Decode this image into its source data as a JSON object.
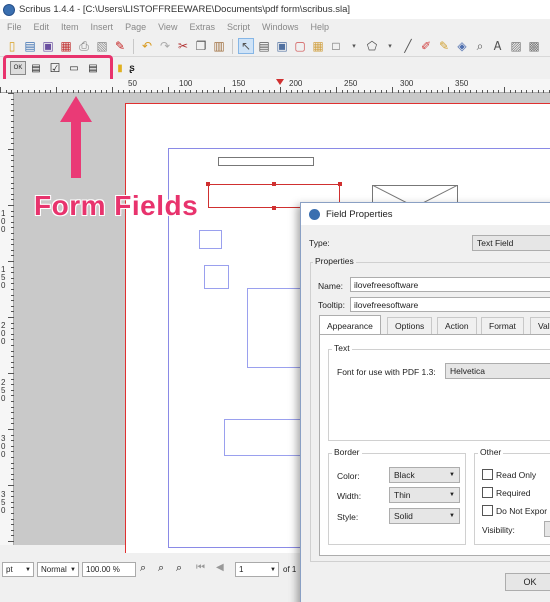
{
  "window": {
    "title": "Scribus 1.4.4 - [C:\\Users\\LISTOFFREEWARE\\Documents\\pdf form\\scribus.sla]"
  },
  "menu": [
    "File",
    "Edit",
    "Item",
    "Insert",
    "Page",
    "View",
    "Extras",
    "Script",
    "Windows",
    "Help"
  ],
  "ruler": {
    "h_labels": [
      "50",
      "100",
      "150",
      "200",
      "250",
      "300",
      "350"
    ],
    "v_labels": [
      "1\n0\n0",
      "1\n5\n0",
      "2\n0\n0",
      "2\n5\n0",
      "3\n0\n0",
      "3\n5\n0",
      "4\n0\n0"
    ]
  },
  "annotation": {
    "label": "Form Fields"
  },
  "status": {
    "unit": "pt",
    "mode": "Normal",
    "zoom": "100.00 %",
    "page": "1",
    "of": "of 1"
  },
  "dialog": {
    "title": "Field Properties",
    "type_label": "Type:",
    "type_value": "Text Field",
    "properties_title": "Properties",
    "name_label": "Name:",
    "name_value": "ilovefreesoftware",
    "tooltip_label": "Tooltip:",
    "tooltip_value": "ilovefreesoftware",
    "tabs": [
      "Appearance",
      "Options",
      "Action",
      "Format",
      "Val"
    ],
    "text_group": "Text",
    "font_label": "Font for use with PDF 1.3:",
    "font_value": "Helvetica",
    "border_group": "Border",
    "color_label": "Color:",
    "color_value": "Black",
    "width_label": "Width:",
    "width_value": "Thin",
    "style_label": "Style:",
    "style_value": "Solid",
    "other_group": "Other",
    "read_only": "Read Only",
    "required": "Required",
    "do_not_export": "Do Not Expor",
    "visibility_label": "Visibility:",
    "ok": "OK"
  },
  "colors": {
    "accent": "#e8336d",
    "page_border": "#e03030",
    "margin": "#8a8ae6"
  }
}
